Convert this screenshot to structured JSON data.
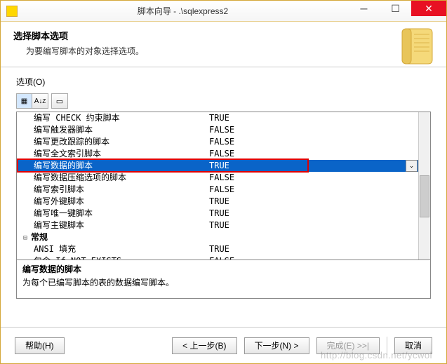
{
  "window": {
    "title": "脚本向导 - .\\sqlexpress2"
  },
  "header": {
    "title": "选择脚本选项",
    "subtitle": "为要编写脚本的对象选择选项。"
  },
  "options_label": "选项(O)",
  "rows": [
    {
      "name": "编写 CHECK 约束脚本",
      "value": "TRUE",
      "selected": false
    },
    {
      "name": "编写触发器脚本",
      "value": "FALSE",
      "selected": false
    },
    {
      "name": "编写更改跟踪的脚本",
      "value": "FALSE",
      "selected": false
    },
    {
      "name": "编写全文索引脚本",
      "value": "FALSE",
      "selected": false
    },
    {
      "name": "编写数据的脚本",
      "value": "TRUE",
      "selected": true
    },
    {
      "name": "编写数据压缩选项的脚本",
      "value": "FALSE",
      "selected": false
    },
    {
      "name": "编写索引脚本",
      "value": "FALSE",
      "selected": false
    },
    {
      "name": "编写外键脚本",
      "value": "TRUE",
      "selected": false
    },
    {
      "name": "编写唯一键脚本",
      "value": "TRUE",
      "selected": false
    },
    {
      "name": "编写主键脚本",
      "value": "TRUE",
      "selected": false
    }
  ],
  "category": {
    "tree": "⊟",
    "label": "常规"
  },
  "extra_rows": [
    {
      "name": "ANSI 填充",
      "value": "TRUE"
    },
    {
      "name": "包含 If NOT EXISTS",
      "value": "FALSE"
    }
  ],
  "description": {
    "title": "编写数据的脚本",
    "body": "为每个已编写脚本的表的数据编写脚本。"
  },
  "buttons": {
    "help": "帮助(H)",
    "back": "< 上一步(B)",
    "next": "下一步(N) >",
    "finish": "完成(E) >>|",
    "cancel": "取消"
  },
  "watermark": "http://blog.csdn.net/ycwol"
}
